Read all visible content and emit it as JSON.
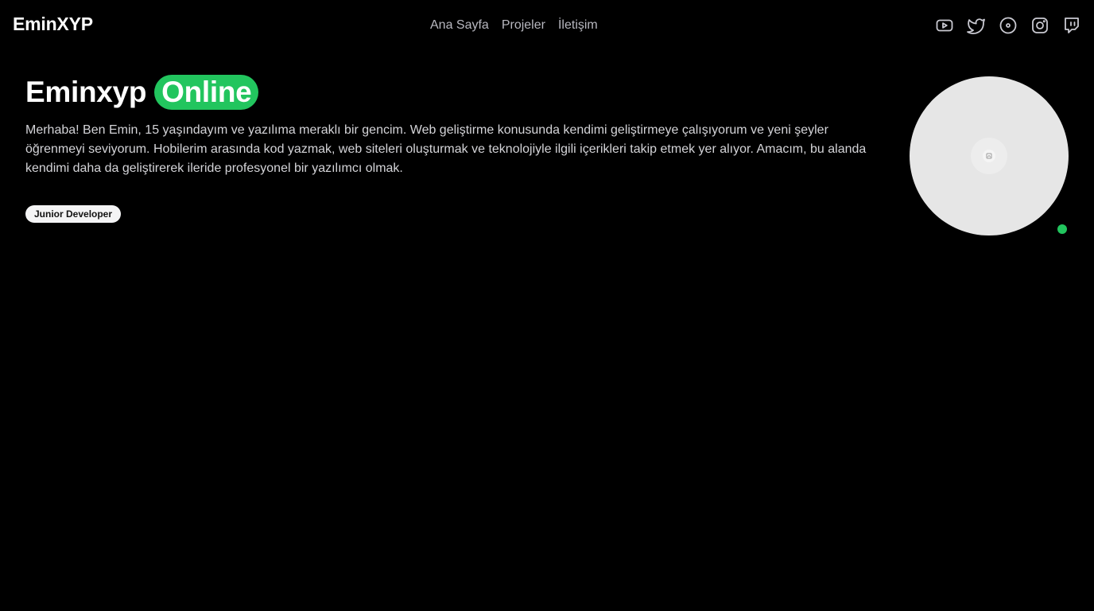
{
  "header": {
    "brand": "EminXYP",
    "nav": [
      {
        "label": "Ana Sayfa"
      },
      {
        "label": "Projeler"
      },
      {
        "label": "İletişim"
      }
    ],
    "social": [
      {
        "icon": "youtube-icon"
      },
      {
        "icon": "twitter-icon"
      },
      {
        "icon": "disc-icon"
      },
      {
        "icon": "instagram-icon"
      },
      {
        "icon": "twitch-icon"
      }
    ]
  },
  "hero": {
    "name": "Eminxyp",
    "status": "Online",
    "bio": "Merhaba! Ben Emin, 15 yaşındayım ve yazılıma meraklı bir gencim. Web geliştirme konusunda kendimi geliştirmeye çalışıyorum ve yeni şeyler öğrenmeyi seviyorum. Hobilerim arasında kod yazmak, web siteleri oluşturmak ve teknolojiyle ilgili içerikleri takip etmek yer alıyor. Amacım, bu alanda kendimi daha da geliştirerek ileride profesyonel bir yazılımcı olmak.",
    "role": "Junior Developer"
  },
  "colors": {
    "background": "#000000",
    "accent_online": "#22c55e",
    "nav_text": "#b8b8c0",
    "body_text": "#d4d4d8"
  }
}
